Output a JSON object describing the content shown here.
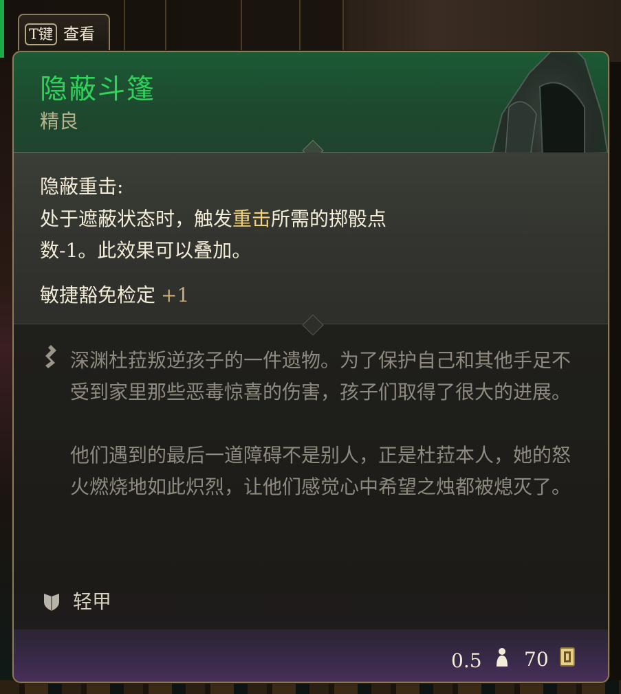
{
  "key_hint": {
    "key": "T键",
    "label": "查看"
  },
  "item": {
    "name": "隐蔽斗篷",
    "rarity": "精良"
  },
  "effect": {
    "title": "隐蔽重击:",
    "desc_prefix": "处于遮蔽状态时，触发",
    "desc_highlight": "重击",
    "desc_suffix": "所需的掷骰点数-1。此效果可以叠加。"
  },
  "bonus": {
    "label": "敏捷豁免检定",
    "value": "+1"
  },
  "lore": {
    "paragraph1": "深渊杜菈叛逆孩子的一件遗物。为了保护自己和其他手足不受到家里那些恶毒惊喜的伤害，孩子们取得了很大的进展。",
    "paragraph2": "他们遇到的最后一道障碍不是别人，正是杜菈本人，她的怒火燃烧地如此炽烈，让他们感觉心中希望之烛都被熄灭了。"
  },
  "armor_type": "轻甲",
  "footer": {
    "weight": "0.5",
    "price": "70"
  },
  "colors": {
    "name": "#2fd35a",
    "highlight": "#f4d27a",
    "border": "#8e7a55"
  },
  "icons": [
    "lore-quill-icon",
    "armor-shield-icon",
    "weight-icon",
    "gold-coin-icon",
    "cloak-image"
  ]
}
